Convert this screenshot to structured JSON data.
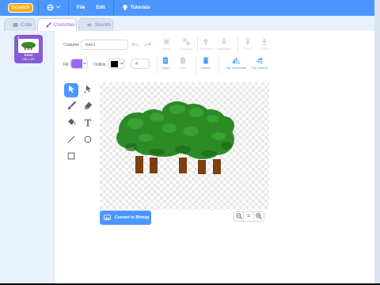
{
  "menu": {
    "logo": "Scratch",
    "file": "File",
    "edit": "Edit",
    "tutorials": "Tutorials"
  },
  "tabs": [
    {
      "label": "Code"
    },
    {
      "label": "Costumes"
    },
    {
      "label": "Sounds"
    }
  ],
  "costume_list": [
    {
      "number": "1",
      "name": "tree1",
      "size": "146 x 157"
    }
  ],
  "editor": {
    "costume_label": "Costume",
    "costume_name": "tree1",
    "toolbar": {
      "group": "Group",
      "ungroup": "Ungroup",
      "forward": "Forward",
      "backward": "Backward",
      "front": "Front",
      "back": "Back",
      "copy": "Copy",
      "paste": "Paste",
      "delete": "Delete",
      "flip_horizontal": "Flip Horizontal",
      "flip_vertical": "Flip Vertical"
    },
    "fill_label": "Fill",
    "fill_color": "#9966ff",
    "outline_label": "Outline",
    "outline_color": "#000000",
    "outline_width": "4",
    "convert_button": "Convert to Bitmap",
    "zoom": {
      "out": "−",
      "reset": "=",
      "in": "+"
    }
  },
  "colors": {
    "accent": "#4c97ff",
    "purple": "#855cd6",
    "logo": "#ffab19",
    "tree_green": "#2f8a2b",
    "trunk": "#8b4513"
  }
}
